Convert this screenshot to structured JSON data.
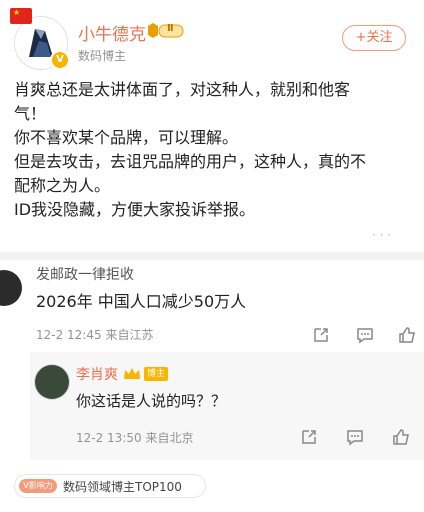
{
  "header": {
    "name": "小牛德克",
    "level_badge": "Ⅱ",
    "subtitle": "数码博主",
    "follow_label": "+关注",
    "verified_mark": "V"
  },
  "post": {
    "text": "肖爽总还是太讲体面了，对这种人，就别和他客\n气！\n你不喜欢某个品牌，可以理解。\n但是去攻击，去诅咒品牌的用户，这种人，真的不\n配称之为人。\nID我没隐藏，方便大家投诉举报。"
  },
  "comment": {
    "name": "发邮政一律拒收",
    "text": "2026年 中国人口减少50万人",
    "meta": "12-2 12:45  来自江苏"
  },
  "reply": {
    "name": "李肖爽",
    "badge_label": "博主",
    "text": "你这话是人说的吗？？",
    "meta": "12-2 13:50  来自北京"
  },
  "footer": {
    "v_label": "V影响力",
    "text": "数码领域博主TOP100"
  }
}
